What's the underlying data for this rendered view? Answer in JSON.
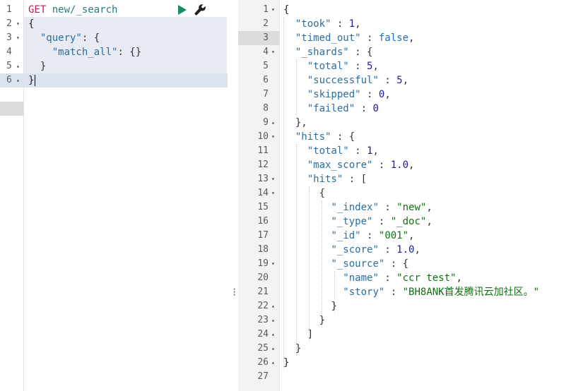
{
  "request": {
    "method": "GET",
    "url": "new/_search",
    "lines": [
      {
        "n": "1",
        "fold": ""
      },
      {
        "n": "2",
        "fold": "▾"
      },
      {
        "n": "3",
        "fold": "▾"
      },
      {
        "n": "4",
        "fold": ""
      },
      {
        "n": "5",
        "fold": "▴"
      },
      {
        "n": "6",
        "fold": "▴"
      }
    ],
    "query_key": "\"query\"",
    "match_all_key": "\"match_all\"",
    "match_all_value": "{}"
  },
  "response": {
    "line_numbers": [
      "1",
      "2",
      "3",
      "4",
      "5",
      "6",
      "7",
      "8",
      "9",
      "10",
      "11",
      "12",
      "13",
      "14",
      "15",
      "16",
      "17",
      "18",
      "19",
      "20",
      "21",
      "22",
      "23",
      "24",
      "25",
      "26",
      "27"
    ],
    "folds": [
      "▾",
      "",
      "",
      "▾",
      "",
      "",
      "",
      "",
      "▴",
      "▾",
      "",
      "",
      "▾",
      "▾",
      "",
      "",
      "",
      "",
      "▾",
      "",
      "",
      "▴",
      "▴",
      "▴",
      "▴",
      "▴",
      ""
    ],
    "took_key": "\"took\"",
    "took_val": "1",
    "timed_out_key": "\"timed_out\"",
    "timed_out_val": "false",
    "shards_key": "\"_shards\"",
    "total_key": "\"total\"",
    "shards_total_val": "5",
    "successful_key": "\"successful\"",
    "successful_val": "5",
    "skipped_key": "\"skipped\"",
    "skipped_val": "0",
    "failed_key": "\"failed\"",
    "failed_val": "0",
    "hits_key": "\"hits\"",
    "hits_total_val": "1",
    "max_score_key": "\"max_score\"",
    "max_score_val": "1.0",
    "index_key": "\"_index\"",
    "index_val": "\"new\"",
    "type_key": "\"_type\"",
    "type_val": "\"_doc\"",
    "id_key": "\"_id\"",
    "id_val": "\"001\"",
    "score_key": "\"_score\"",
    "score_val": "1.0",
    "source_key": "\"_source\"",
    "name_key": "\"name\"",
    "name_val": "\"ccr test\"",
    "story_key": "\"story\"",
    "story_val": "\"BH8ANK首发腾讯云加社区。\""
  },
  "icons": {
    "run": "play-icon",
    "settings": "wrench-icon",
    "splitter": "vertical-dots-icon"
  },
  "colors": {
    "run_green": "#1b8a6b",
    "string_green": "#127012",
    "key_blue": "#2a6ea3",
    "method_pink": "#c2185b"
  }
}
